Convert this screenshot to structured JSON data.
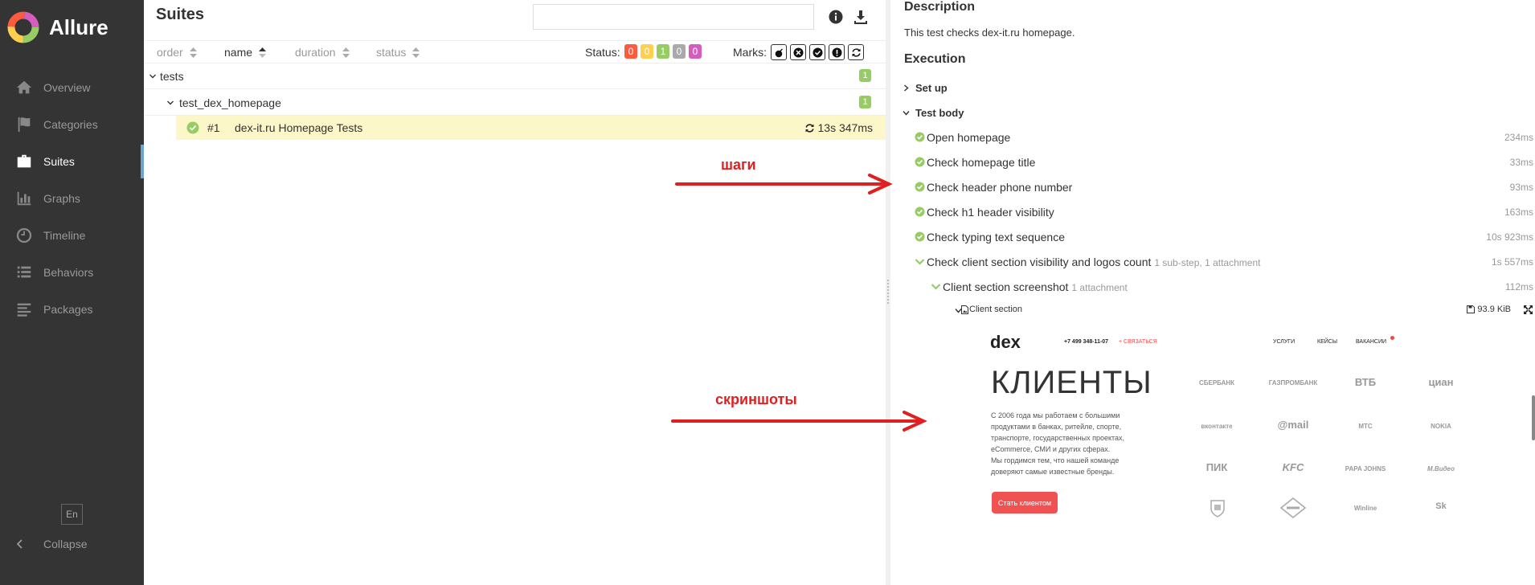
{
  "app": {
    "name": "Allure"
  },
  "sidebar": {
    "items": [
      {
        "label": "Overview",
        "icon": "home-icon"
      },
      {
        "label": "Categories",
        "icon": "flag-icon"
      },
      {
        "label": "Suites",
        "icon": "briefcase-icon",
        "active": true
      },
      {
        "label": "Graphs",
        "icon": "bar-chart-icon"
      },
      {
        "label": "Timeline",
        "icon": "clock-icon"
      },
      {
        "label": "Behaviors",
        "icon": "list-icon"
      },
      {
        "label": "Packages",
        "icon": "align-left-icon"
      }
    ],
    "lang": "En",
    "collapse": "Collapse"
  },
  "suites": {
    "title": "Suites",
    "search_value": "",
    "sort": {
      "order": "order",
      "name": "name",
      "duration": "duration",
      "status": "status"
    },
    "status_label": "Status:",
    "status_counts": [
      {
        "value": "0",
        "color": "#fd5a3e"
      },
      {
        "value": "0",
        "color": "#ffd050"
      },
      {
        "value": "1",
        "color": "#97cc64"
      },
      {
        "value": "0",
        "color": "#aaaaaa"
      },
      {
        "value": "0",
        "color": "#d35ebe"
      }
    ],
    "marks_label": "Marks:",
    "tree": {
      "group": {
        "label": "tests",
        "count": "1"
      },
      "subgroup": {
        "label": "test_dex_homepage",
        "count": "1"
      },
      "test": {
        "number": "#1",
        "name": "dex-it.ru Homepage Tests",
        "duration": "13s 347ms"
      }
    }
  },
  "details": {
    "description_heading": "Description",
    "description_text": "This test checks dex-it.ru homepage.",
    "execution_heading": "Execution",
    "setup_label": "Set up",
    "body_label": "Test body",
    "steps": [
      {
        "name": "Open homepage",
        "meta": "",
        "duration": "234ms"
      },
      {
        "name": "Check homepage title",
        "meta": "",
        "duration": "33ms"
      },
      {
        "name": "Check header phone number",
        "meta": "",
        "duration": "93ms"
      },
      {
        "name": "Check h1 header visibility",
        "meta": "",
        "duration": "163ms"
      },
      {
        "name": "Check typing text sequence",
        "meta": "",
        "duration": "10s 923ms"
      },
      {
        "name": "Check client section visibility and logos count",
        "meta": "1 sub-step, 1 attachment",
        "duration": "1s 557ms"
      }
    ],
    "substep": {
      "name": "Client section screenshot",
      "meta": "1 attachment",
      "duration": "112ms"
    },
    "attachment": {
      "name": "Client section",
      "size": "93.9 KiB"
    }
  },
  "screenshot": {
    "logo": "dex",
    "phone": "+7 499 348-11-07",
    "contact": "+ СВЯЗАТЬСЯ",
    "menu": [
      "УСЛУГИ",
      "КЕЙСЫ",
      "ВАКАНСИИ"
    ],
    "title": "КЛИЕНТЫ",
    "text": "С 2006 года мы работаем с большими\nпродуктами в банках, ритейле, спорте,\nтранспорте, государственных проектах,\neCommerce, СМИ и других сферах.\nМы гордимся тем, что нашей команде\nдоверяют самые известные бренды.",
    "button": "Стать клиентом",
    "logos": [
      "СБЕРБАНК",
      "ГАЗПРОМБАНК",
      "ВТБ",
      "циан",
      "вконтакте",
      "@mail",
      "МТС",
      "NOKIA",
      "ПИК",
      "KFC",
      "PAPA JOHNS",
      "M.Видео",
      "",
      "",
      "Winline",
      "Sk"
    ]
  },
  "annotations": {
    "steps": "шаги",
    "screenshots": "скриншоты"
  }
}
